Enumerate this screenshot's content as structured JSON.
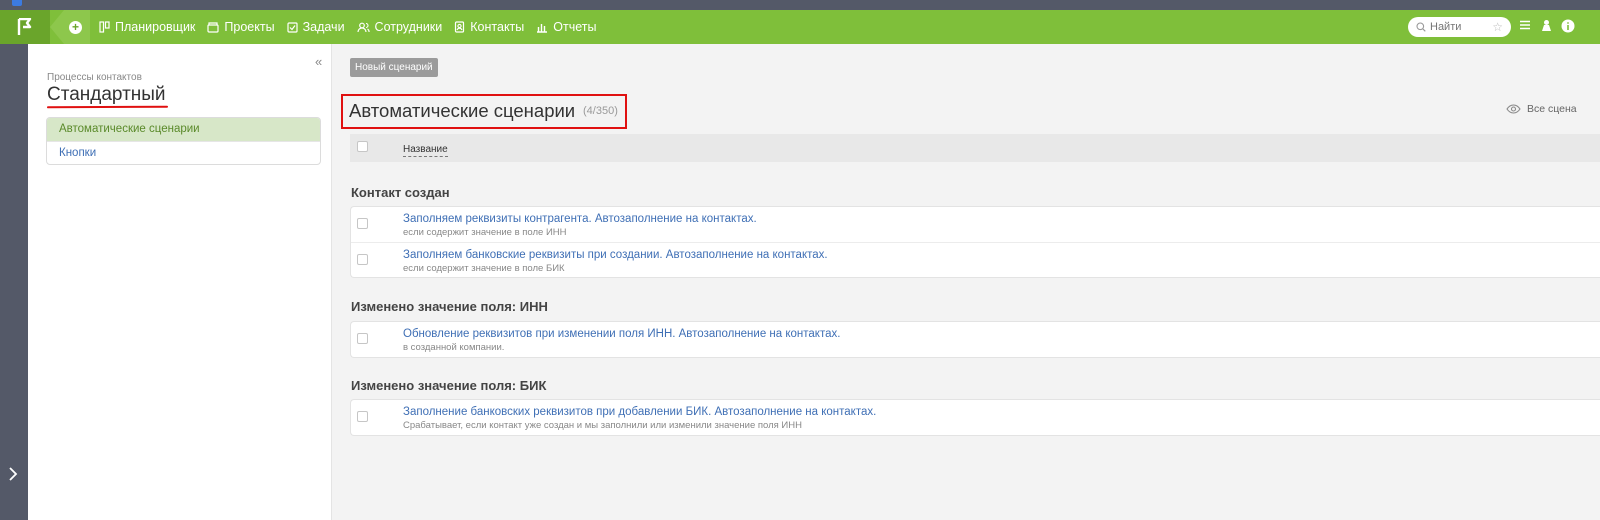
{
  "nav": {
    "items": [
      {
        "label": "Планировщик",
        "icon": "planner-icon"
      },
      {
        "label": "Проекты",
        "icon": "projects-icon"
      },
      {
        "label": "Задачи",
        "icon": "tasks-icon"
      },
      {
        "label": "Сотрудники",
        "icon": "employees-icon"
      },
      {
        "label": "Контакты",
        "icon": "contacts-icon"
      },
      {
        "label": "Отчеты",
        "icon": "reports-icon"
      }
    ],
    "search_placeholder": "Найти"
  },
  "sidebar": {
    "caption": "Процессы контактов",
    "title": "Стандартный",
    "items": [
      {
        "label": "Автоматические сценарии",
        "active": true
      },
      {
        "label": "Кнопки",
        "active": false
      }
    ]
  },
  "main": {
    "new_button": "Новый сценарий",
    "title": "Автоматические сценарии",
    "count": "(4/350)",
    "all_scenarios": "Все сцена",
    "column_name": "Название",
    "groups": [
      {
        "title": "Контакт создан",
        "rows": [
          {
            "title": "Заполняем реквизиты контрагента. Автозаполнение на контактах.",
            "sub": "если содержит значение в поле ИНН"
          },
          {
            "title": "Заполняем банковские реквизиты при создании. Автозаполнение на контактах.",
            "sub": "если содержит значение в поле БИК"
          }
        ]
      },
      {
        "title": "Изменено значение поля: ИНН",
        "rows": [
          {
            "title": "Обновление реквизитов при изменении поля ИНН. Автозаполнение на контактах.",
            "sub": "в созданной компании."
          }
        ]
      },
      {
        "title": "Изменено значение поля: БИК",
        "rows": [
          {
            "title": "Заполнение банковских реквизитов при добавлении БИК. Автозаполнение на контактах.",
            "sub": "Срабатывает, если контакт уже создан и мы заполнили или изменили значение поля ИНН"
          }
        ]
      }
    ]
  },
  "colors": {
    "topbar": "#7fbf3a",
    "rail": "#545968",
    "link": "#3f6fb5",
    "highlight": "#e01010",
    "active_item_bg": "#d7e7c8"
  }
}
